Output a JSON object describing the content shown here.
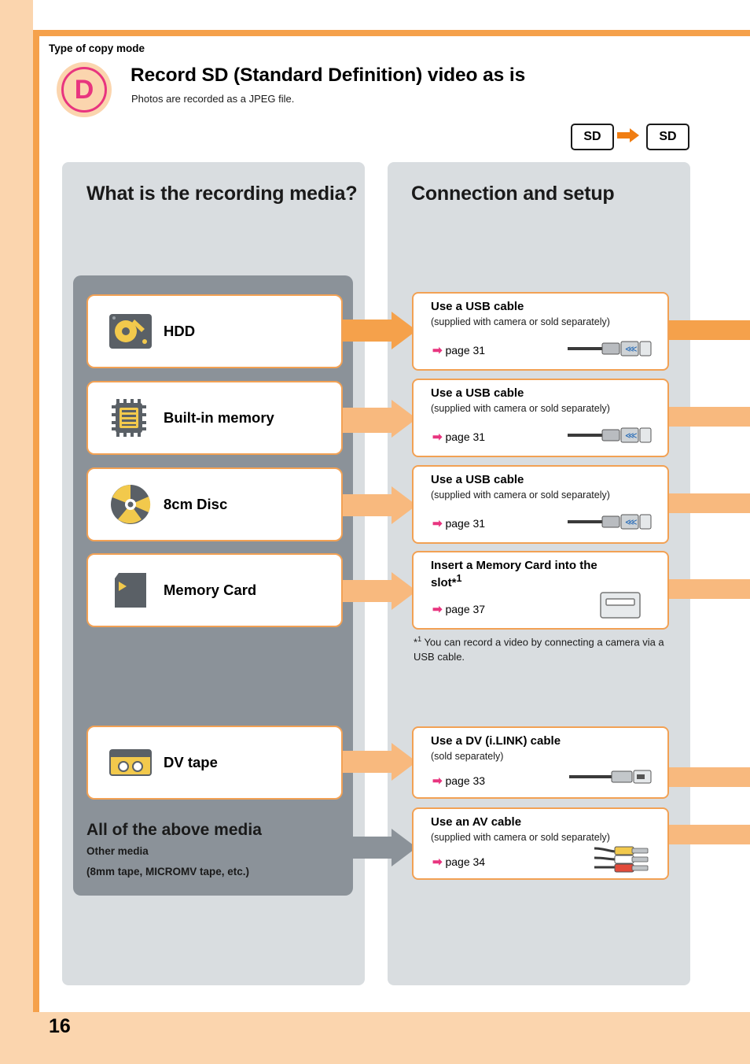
{
  "page": {
    "number": "16",
    "type_label": "Type of copy mode",
    "badge_letter": "D",
    "title": "Record SD (Standard Definition) video as is",
    "subtitle": "Photos are recorded as a JPEG file.",
    "chip_source": "SD",
    "chip_dest": "SD"
  },
  "panels": {
    "left_title": "What is the recording media?",
    "right_title": "Connection and setup"
  },
  "media": [
    {
      "label": "HDD",
      "icon": "hdd-icon"
    },
    {
      "label": "Built-in memory",
      "icon": "memory-chip-icon"
    },
    {
      "label": "8cm Disc",
      "icon": "disc-icon"
    },
    {
      "label": "Memory Card",
      "icon": "memory-card-icon"
    },
    {
      "label": "DV tape",
      "icon": "dv-tape-icon"
    }
  ],
  "all_media": {
    "title": "All of the above media",
    "sub1": "Other media",
    "sub2": "(8mm tape, MICROMV tape, etc.)"
  },
  "connections": [
    {
      "title": "Use a USB cable",
      "note": "(supplied with camera or sold separately)",
      "page": "page 31",
      "icon": "usb-cable-icon"
    },
    {
      "title": "Use a USB cable",
      "note": "(supplied with camera or sold separately)",
      "page": "page 31",
      "icon": "usb-cable-icon"
    },
    {
      "title": "Use a USB cable",
      "note": "(supplied with camera or sold separately)",
      "page": "page 31",
      "icon": "usb-cable-icon"
    },
    {
      "title": "Insert a Memory Card into the slot*1",
      "note": "",
      "page": "page 37",
      "icon": "memory-card-slot-icon"
    },
    {
      "title": "Use a DV (i.LINK) cable",
      "note": "(sold separately)",
      "page": "page 33",
      "icon": "dv-cable-icon"
    },
    {
      "title": "Use an AV cable",
      "note": "(supplied with camera or sold separately)",
      "page": "page 34",
      "icon": "av-cable-icon"
    }
  ],
  "footnote": "*1 You can record a video by connecting a camera via a USB cable."
}
